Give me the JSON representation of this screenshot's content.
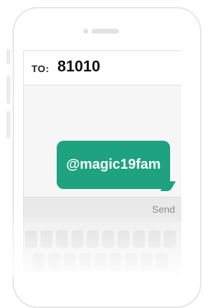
{
  "compose": {
    "to_label": "TO:",
    "to_value": "81010"
  },
  "message": {
    "text": "@magic19fam",
    "bubble_color": "#1ea27f"
  },
  "send_bar": {
    "send_label": "Send"
  },
  "icons": [
    "camera-icon",
    "speaker-icon"
  ]
}
